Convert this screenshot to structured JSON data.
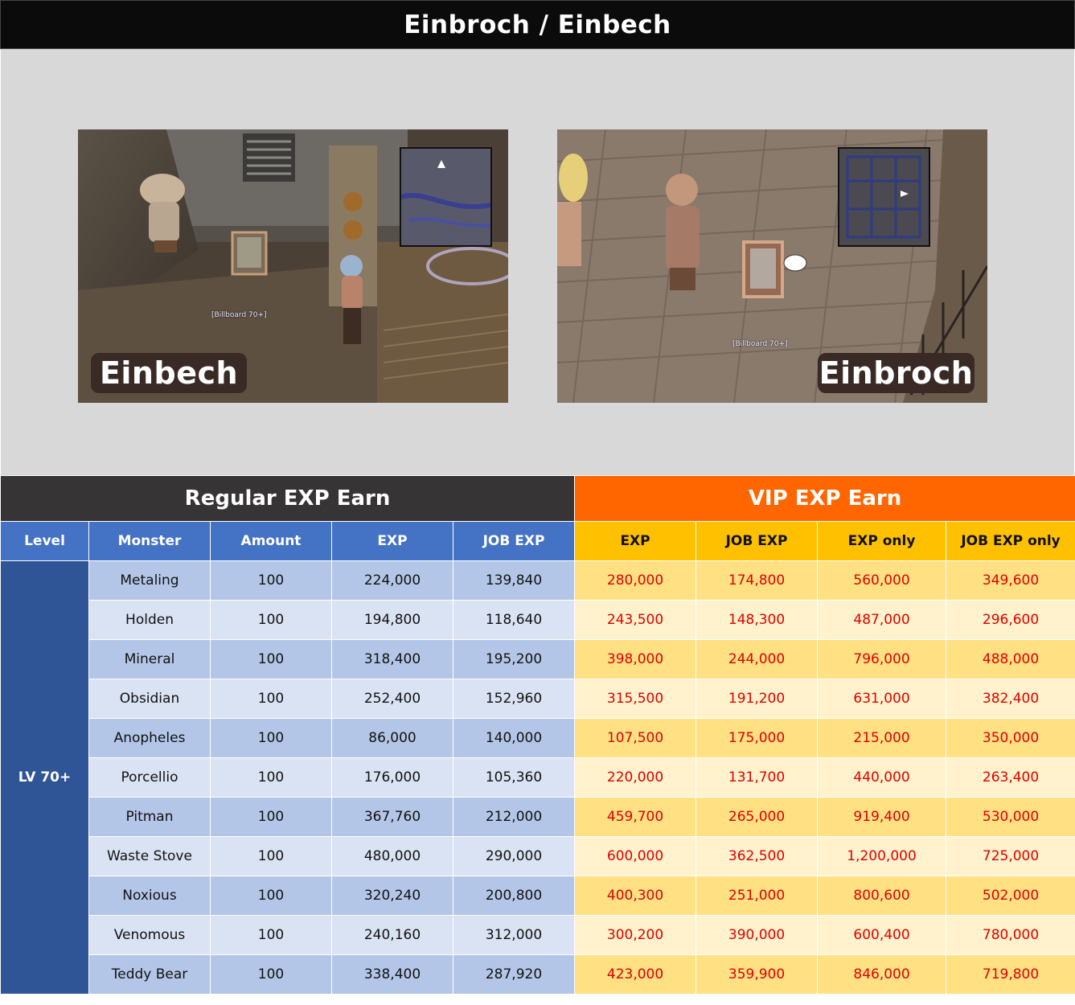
{
  "title": "Einbroch / Einbech",
  "screenshots": {
    "left": {
      "map_tag": "Einbech",
      "billboard_label": "[Billboard 70+]"
    },
    "right": {
      "map_tag": "Einbroch",
      "billboard_label": "[Billboard 70+]"
    }
  },
  "table": {
    "regular_header": "Regular EXP Earn",
    "vip_header": "VIP EXP Earn",
    "columns": {
      "level": "Level",
      "monster": "Monster",
      "amount": "Amount",
      "exp": "EXP",
      "job_exp": "JOB EXP",
      "vip_exp": "EXP",
      "vip_job_exp": "JOB EXP",
      "vip_exp_only": "EXP only",
      "vip_job_exp_only": "JOB EXP only"
    },
    "level_label": "LV 70+",
    "rows": [
      {
        "monster": "Metaling",
        "amount": "100",
        "exp": "224,000",
        "job": "139,840",
        "vexp": "280,000",
        "vjob": "174,800",
        "vexp_only": "560,000",
        "vjob_only": "349,600"
      },
      {
        "monster": "Holden",
        "amount": "100",
        "exp": "194,800",
        "job": "118,640",
        "vexp": "243,500",
        "vjob": "148,300",
        "vexp_only": "487,000",
        "vjob_only": "296,600"
      },
      {
        "monster": "Mineral",
        "amount": "100",
        "exp": "318,400",
        "job": "195,200",
        "vexp": "398,000",
        "vjob": "244,000",
        "vexp_only": "796,000",
        "vjob_only": "488,000"
      },
      {
        "monster": "Obsidian",
        "amount": "100",
        "exp": "252,400",
        "job": "152,960",
        "vexp": "315,500",
        "vjob": "191,200",
        "vexp_only": "631,000",
        "vjob_only": "382,400"
      },
      {
        "monster": "Anopheles",
        "amount": "100",
        "exp": "86,000",
        "job": "140,000",
        "vexp": "107,500",
        "vjob": "175,000",
        "vexp_only": "215,000",
        "vjob_only": "350,000"
      },
      {
        "monster": "Porcellio",
        "amount": "100",
        "exp": "176,000",
        "job": "105,360",
        "vexp": "220,000",
        "vjob": "131,700",
        "vexp_only": "440,000",
        "vjob_only": "263,400"
      },
      {
        "monster": "Pitman",
        "amount": "100",
        "exp": "367,760",
        "job": "212,000",
        "vexp": "459,700",
        "vjob": "265,000",
        "vexp_only": "919,400",
        "vjob_only": "530,000"
      },
      {
        "monster": "Waste Stove",
        "amount": "100",
        "exp": "480,000",
        "job": "290,000",
        "vexp": "600,000",
        "vjob": "362,500",
        "vexp_only": "1,200,000",
        "vjob_only": "725,000"
      },
      {
        "monster": "Noxious",
        "amount": "100",
        "exp": "320,240",
        "job": "200,800",
        "vexp": "400,300",
        "vjob": "251,000",
        "vexp_only": "800,600",
        "vjob_only": "502,000"
      },
      {
        "monster": "Venomous",
        "amount": "100",
        "exp": "240,160",
        "job": "312,000",
        "vexp": "300,200",
        "vjob": "390,000",
        "vexp_only": "600,400",
        "vjob_only": "780,000"
      },
      {
        "monster": "Teddy Bear",
        "amount": "100",
        "exp": "338,400",
        "job": "287,920",
        "vexp": "423,000",
        "vjob": "359,900",
        "vexp_only": "846,000",
        "vjob_only": "719,800"
      }
    ]
  }
}
